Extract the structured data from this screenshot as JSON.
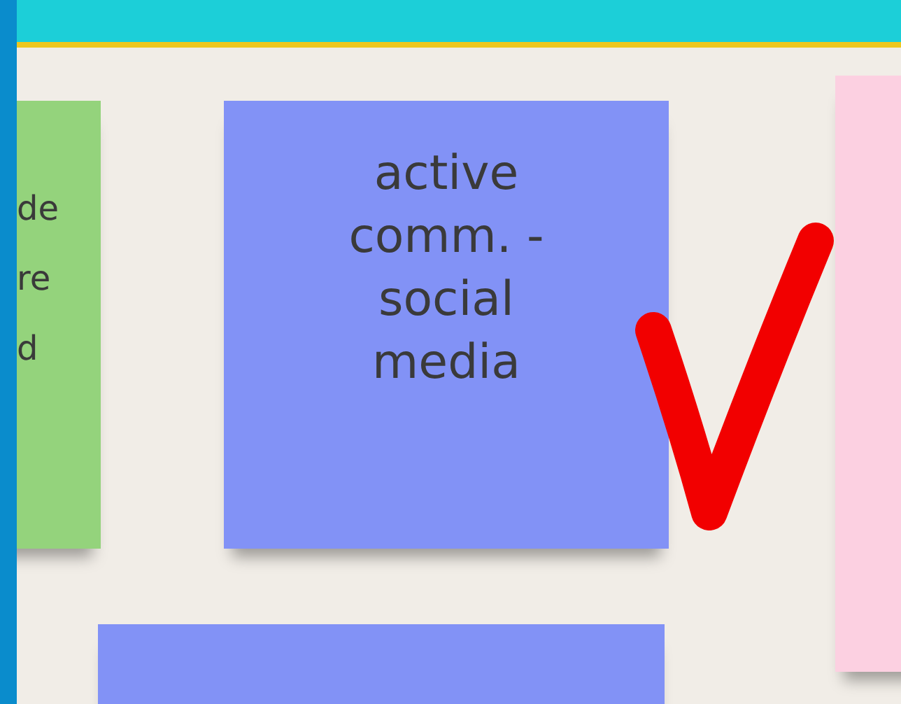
{
  "notes": [
    {
      "color": "#94d37c",
      "lines": [
        "de",
        "re",
        "d"
      ]
    },
    {
      "color": "#8292f6",
      "lines": [
        "active",
        "comm. -",
        "social",
        "media"
      ]
    },
    {
      "color": "#fcd0e1"
    },
    {
      "color": "#8292f6"
    }
  ]
}
